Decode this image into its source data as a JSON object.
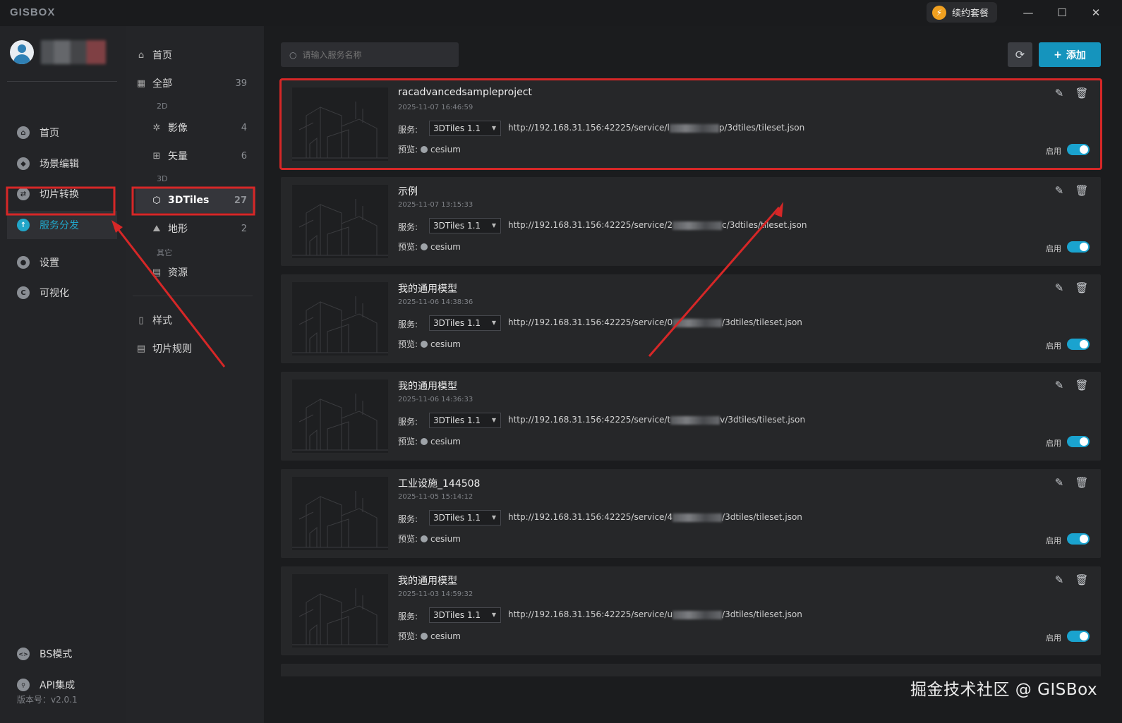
{
  "app": {
    "logo": "GISBOX",
    "renew_label": "续约套餐",
    "renew_icon": "bolt-icon"
  },
  "window": {
    "minimize": "—",
    "maximize": "☐",
    "close": "✕"
  },
  "sidebar": {
    "items": [
      {
        "label": "首页",
        "icon": "home-icon",
        "glyph": "⌂"
      },
      {
        "label": "场景编辑",
        "icon": "cube-icon",
        "glyph": "◆"
      },
      {
        "label": "切片转换",
        "icon": "swap-icon",
        "glyph": "⇄"
      },
      {
        "label": "服务分发",
        "icon": "upload-icon",
        "glyph": "↑",
        "active": true
      },
      {
        "label": "设置",
        "icon": "gear-icon",
        "glyph": "●"
      },
      {
        "label": "可视化",
        "icon": "chart-icon",
        "glyph": "C"
      }
    ],
    "bottom": [
      {
        "label": "BS模式",
        "icon": "code-icon",
        "glyph": "<>"
      },
      {
        "label": "API集成",
        "icon": "plug-icon",
        "glyph": "⚲"
      }
    ],
    "version": "版本号：v2.0.1"
  },
  "subnav": {
    "home": "首页",
    "all": {
      "label": "全部",
      "count": "39"
    },
    "group_2d": "2D",
    "imagery": {
      "label": "影像",
      "count": "4"
    },
    "vector": {
      "label": "矢量",
      "count": "6"
    },
    "group_3d": "3D",
    "tiles3d": {
      "label": "3DTiles",
      "count": "27"
    },
    "terrain": {
      "label": "地形",
      "count": "2"
    },
    "group_other": "其它",
    "resource": {
      "label": "资源"
    },
    "style": "样式",
    "tile_rule": "切片规则"
  },
  "toolbar": {
    "search_placeholder": "请输入服务名称",
    "add_label": "添加",
    "add_icon": "+",
    "refresh_icon": "⟳"
  },
  "card_labels": {
    "service": "服务:",
    "preview": "预览:",
    "preview_value": "cesium",
    "enable": "启用"
  },
  "services": [
    {
      "title": "racadvancedsampleproject",
      "date": "2025-11-07 16:46:59",
      "type": "3DTiles 1.1",
      "url_prefix": "http://192.168.31.156:42225/service/l",
      "url_suffix": "p/3dtiles/tileset.json",
      "enabled": true,
      "highlight": true
    },
    {
      "title": "示例",
      "date": "2025-11-07 13:15:33",
      "type": "3DTiles 1.1",
      "url_prefix": "http://192.168.31.156:42225/service/2",
      "url_suffix": "c/3dtiles/tileset.json",
      "enabled": true
    },
    {
      "title": "我的通用模型",
      "date": "2025-11-06 14:38:36",
      "type": "3DTiles 1.1",
      "url_prefix": "http://192.168.31.156:42225/service/0",
      "url_suffix": "/3dtiles/tileset.json",
      "enabled": true
    },
    {
      "title": "我的通用模型",
      "date": "2025-11-06 14:36:33",
      "type": "3DTiles 1.1",
      "url_prefix": "http://192.168.31.156:42225/service/t",
      "url_suffix": "v/3dtiles/tileset.json",
      "enabled": true
    },
    {
      "title": "工业设施_144508",
      "date": "2025-11-05 15:14:12",
      "type": "3DTiles 1.1",
      "url_prefix": "http://192.168.31.156:42225/service/4",
      "url_suffix": "/3dtiles/tileset.json",
      "enabled": true
    },
    {
      "title": "我的通用模型",
      "date": "2025-11-03 14:59:32",
      "type": "3DTiles 1.1",
      "url_prefix": "http://192.168.31.156:42225/service/u",
      "url_suffix": "/3dtiles/tileset.json",
      "enabled": true
    }
  ],
  "watermark": "掘金技术社区 @ GISBox",
  "colors": {
    "accent": "#1aa3cf",
    "highlight": "#d62727",
    "bg": "#1b1c1e"
  }
}
